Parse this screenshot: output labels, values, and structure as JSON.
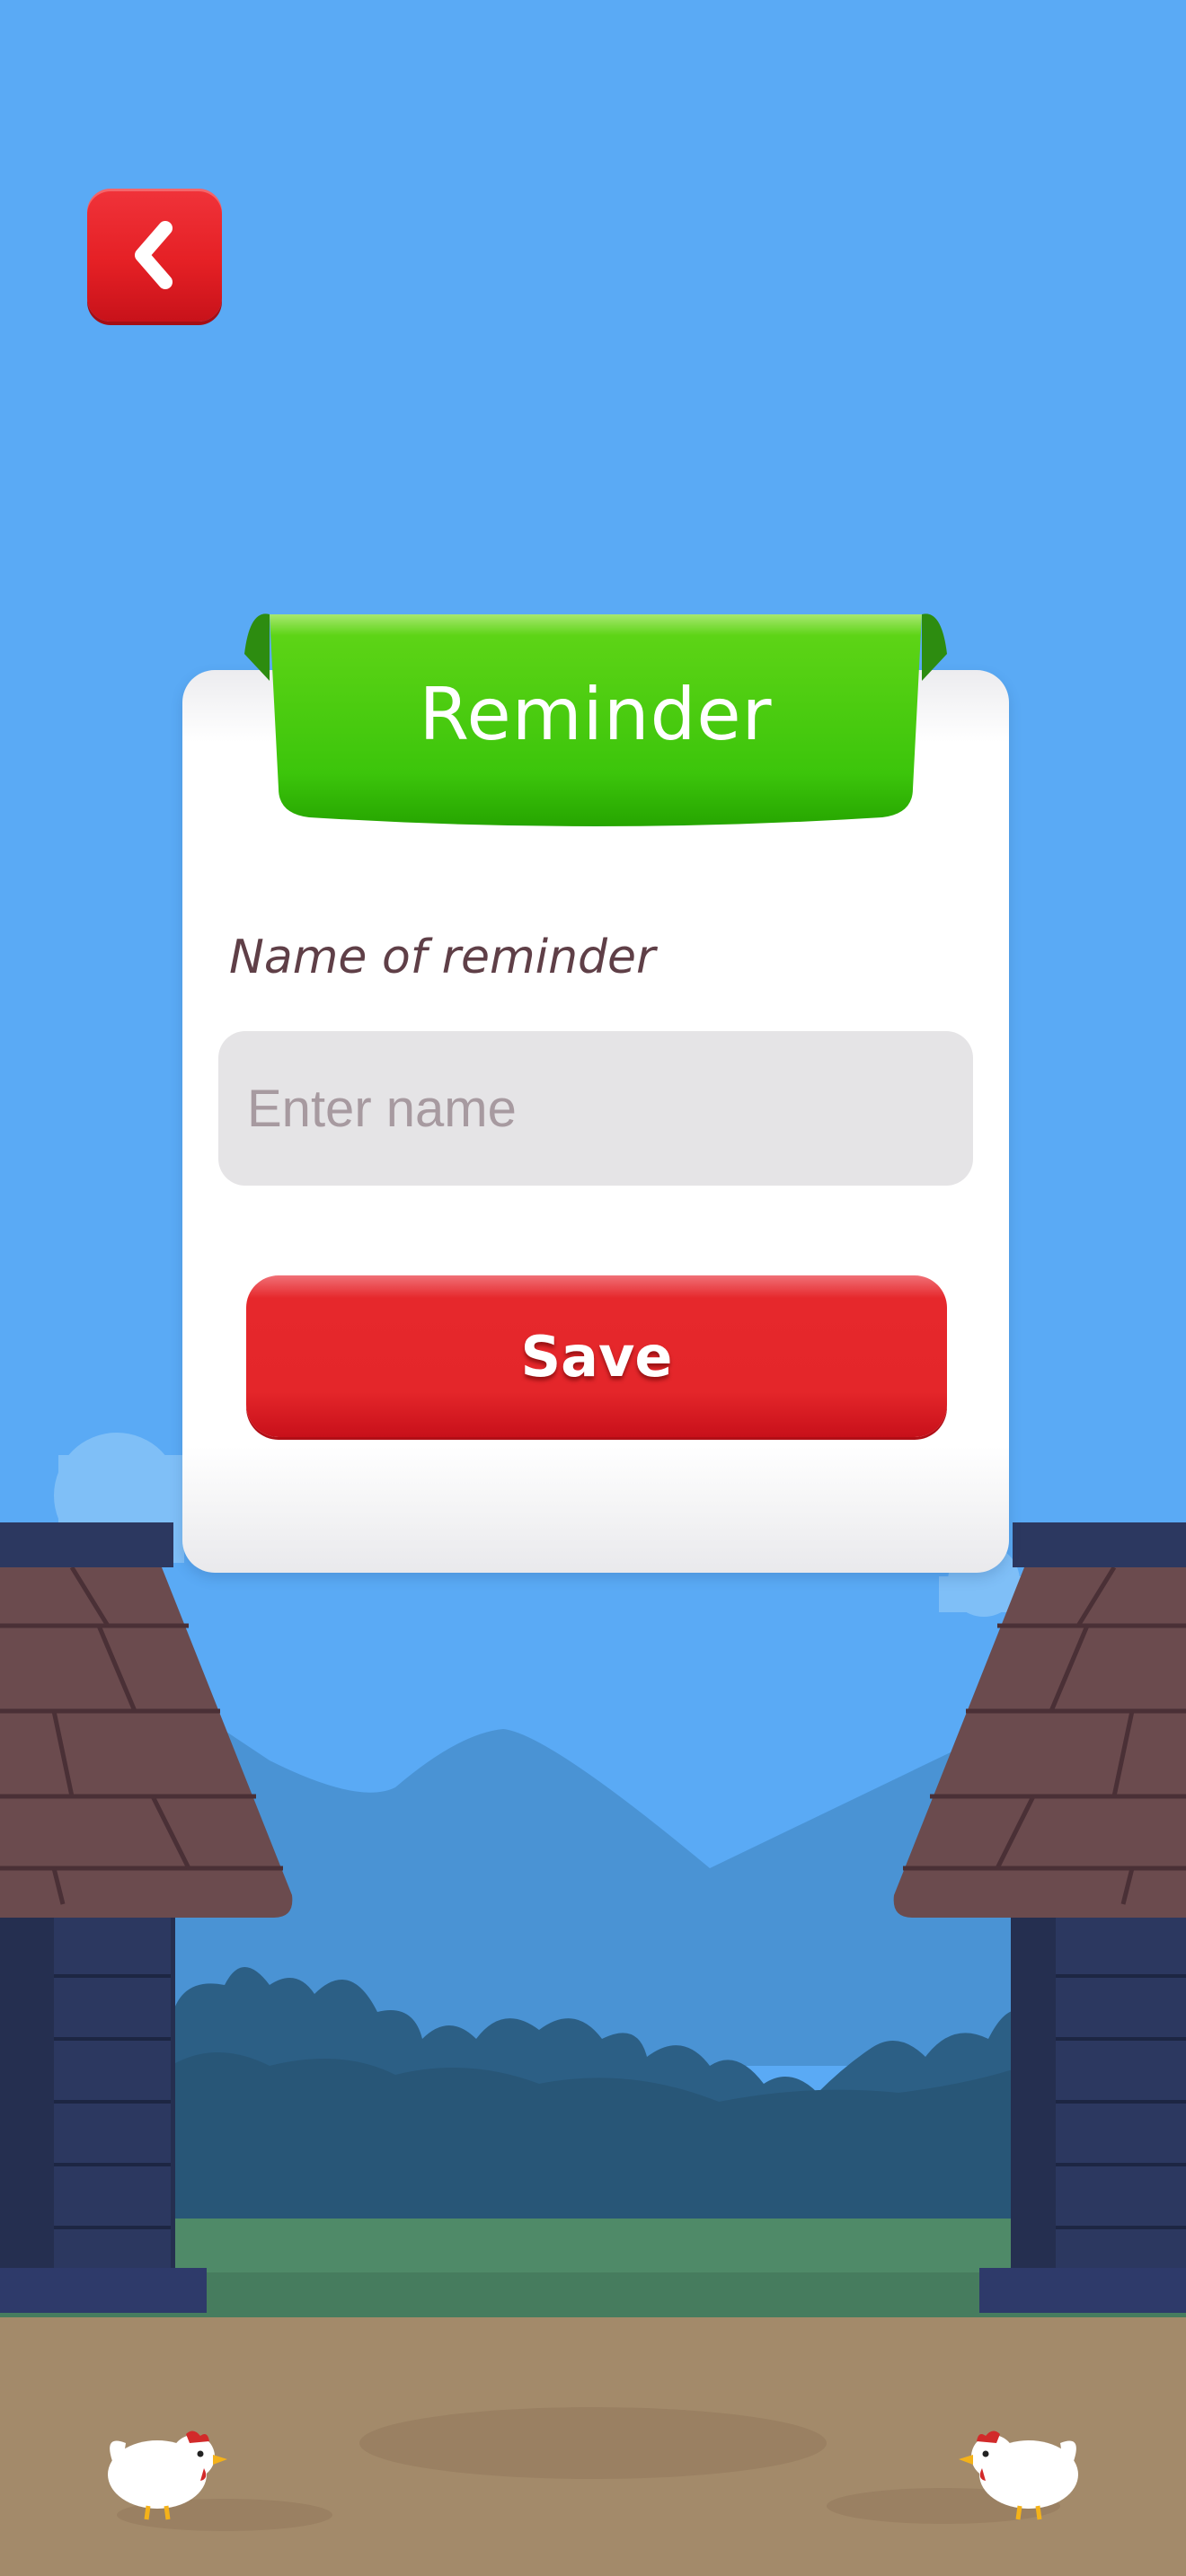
{
  "colors": {
    "sky": "#5aaaf5",
    "ribbon_green": "#3cc50b",
    "accent_red": "#e4262a",
    "card_bg": "#ffffff",
    "label_text": "#5f3f47"
  },
  "header": {
    "back_icon": "chevron-left-icon"
  },
  "dialog": {
    "title": "Reminder",
    "field_label": "Name of reminder",
    "name_input": {
      "value": "",
      "placeholder": "Enter name"
    },
    "save_label": "Save"
  },
  "scenery": {
    "left_chicken_icon": "chicken-icon",
    "right_chicken_icon": "chicken-icon"
  }
}
